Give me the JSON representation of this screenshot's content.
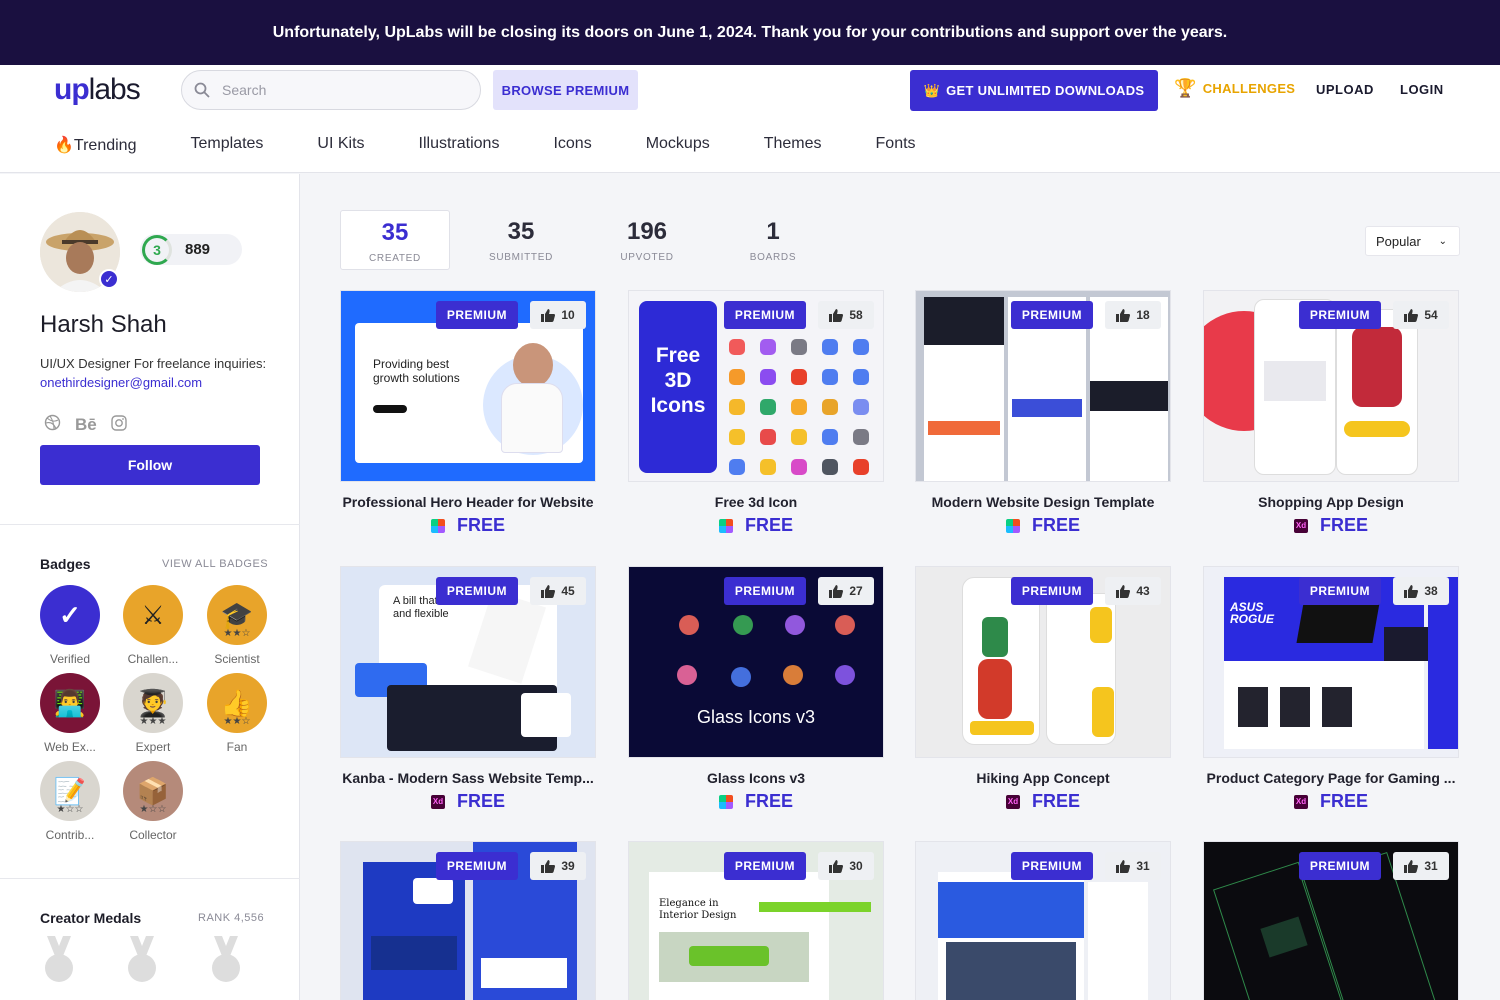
{
  "banner": {
    "text": "Unfortunately, UpLabs will be closing its doors on June 1, 2024. Thank you for your contributions and support over the years."
  },
  "header": {
    "logo_up": "up",
    "logo_labs": "labs",
    "search_placeholder": "Search",
    "browse_premium": "BROWSE PREMIUM",
    "unlimited": "GET UNLIMITED DOWNLOADS",
    "challenges": "CHALLENGES",
    "upload": "UPLOAD",
    "login": "LOGIN",
    "nav": [
      "🔥Trending",
      "Templates",
      "UI Kits",
      "Illustrations",
      "Icons",
      "Mockups",
      "Themes",
      "Fonts"
    ]
  },
  "profile": {
    "level": "3",
    "points": "889",
    "name": "Harsh Shah",
    "bio": "UI/UX Designer For freelance inquiries:",
    "email": "onethirdesigner@gmail.com",
    "socials": [
      "dribbble-icon",
      "behance-icon",
      "instagram-icon"
    ],
    "follow": "Follow"
  },
  "badges": {
    "title": "Badges",
    "view_all": "VIEW ALL BADGES",
    "items": [
      {
        "label": "Verified",
        "color": "#3b2ed1",
        "glyph": "✓",
        "stars": ""
      },
      {
        "label": "Challen...",
        "color": "#e8a42a",
        "glyph": "⚔",
        "stars": ""
      },
      {
        "label": "Scientist",
        "color": "#e8a42a",
        "glyph": "🎓",
        "stars": "★★☆"
      },
      {
        "label": "Web Ex...",
        "color": "#7a1437",
        "glyph": "👨‍💻",
        "stars": ""
      },
      {
        "label": "Expert",
        "color": "#d9d6cf",
        "glyph": "🧑‍🎓",
        "stars": "★★★"
      },
      {
        "label": "Fan",
        "color": "#e8a42a",
        "glyph": "👍",
        "stars": "★★☆"
      },
      {
        "label": "Contrib...",
        "color": "#d9d6cf",
        "glyph": "📝",
        "stars": "★☆☆"
      },
      {
        "label": "Collector",
        "color": "#b58a7a",
        "glyph": "📦",
        "stars": "★☆☆"
      }
    ]
  },
  "medals": {
    "title": "Creator Medals",
    "rank": "RANK 4,556"
  },
  "stats": [
    {
      "num": "35",
      "label": "CREATED"
    },
    {
      "num": "35",
      "label": "SUBMITTED"
    },
    {
      "num": "196",
      "label": "UPVOTED"
    },
    {
      "num": "1",
      "label": "BOARDS"
    }
  ],
  "sort": "Popular",
  "cards": [
    {
      "title": "Professional Hero Header for Website",
      "likes": "10",
      "tool": "figma",
      "price": "FREE",
      "premium": "PREMIUM",
      "thumb_text": "Providing best growth solutions"
    },
    {
      "title": "Free 3d Icon",
      "likes": "58",
      "tool": "figma",
      "price": "FREE",
      "premium": "PREMIUM",
      "thumb_text": "Free 3D Icons"
    },
    {
      "title": "Modern Website Design Template",
      "likes": "18",
      "tool": "figma",
      "price": "FREE",
      "premium": "PREMIUM",
      "thumb_text": ""
    },
    {
      "title": "Shopping App Design",
      "likes": "54",
      "tool": "xd",
      "price": "FREE",
      "premium": "PREMIUM",
      "thumb_text": ""
    },
    {
      "title": "Kanba - Modern Sass Website Temp...",
      "likes": "45",
      "tool": "xd",
      "price": "FREE",
      "premium": "PREMIUM",
      "thumb_text": "A bill that's fair and flexible"
    },
    {
      "title": "Glass Icons v3",
      "likes": "27",
      "tool": "figma",
      "price": "FREE",
      "premium": "PREMIUM",
      "thumb_text": "Glass Icons v3"
    },
    {
      "title": "Hiking App Concept",
      "likes": "43",
      "tool": "xd",
      "price": "FREE",
      "premium": "PREMIUM",
      "thumb_text": ""
    },
    {
      "title": "Product Category Page for Gaming ...",
      "likes": "38",
      "tool": "xd",
      "price": "FREE",
      "premium": "PREMIUM",
      "thumb_text": "ASUS ROGUE"
    },
    {
      "title": "",
      "likes": "39",
      "tool": "",
      "price": "",
      "premium": "PREMIUM",
      "thumb_text": ""
    },
    {
      "title": "",
      "likes": "30",
      "tool": "",
      "price": "",
      "premium": "PREMIUM",
      "thumb_text": "Elegance in Interior Design"
    },
    {
      "title": "",
      "likes": "31",
      "tool": "",
      "price": "",
      "premium": "PREMIUM",
      "thumb_text": ""
    },
    {
      "title": "",
      "likes": "31",
      "tool": "",
      "price": "",
      "premium": "PREMIUM",
      "thumb_text": ""
    }
  ]
}
